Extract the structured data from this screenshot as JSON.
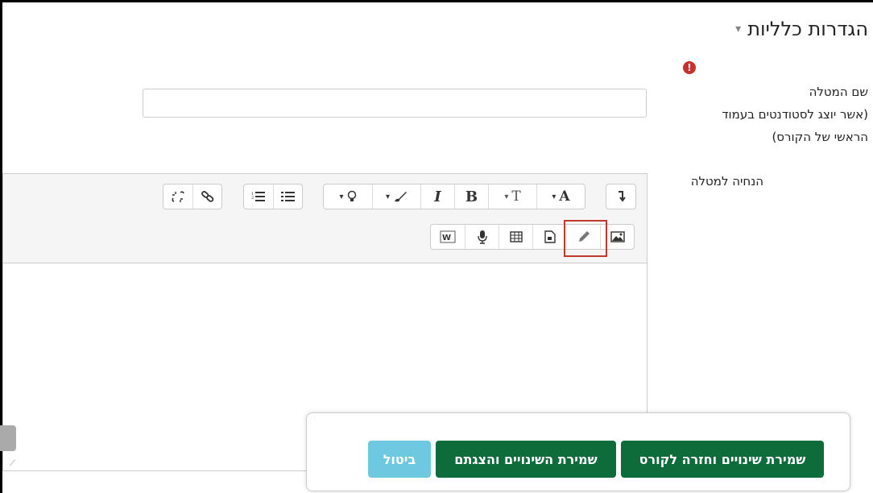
{
  "section": {
    "title": "הגדרות כלליות",
    "caret": "▾"
  },
  "form": {
    "error_icon": "!",
    "name_label": [
      "שם המטלה",
      "(אשר יוצג לסטודנטים בעמוד",
      "הראשי של הקורס)"
    ],
    "name_value": "",
    "instructions_label": "הנחיה למטלה"
  },
  "toolbar": {
    "row1_text": {
      "font_color": "A",
      "font_size": "T",
      "bold": "B",
      "italic": "I",
      "dropdown_caret": "▾"
    },
    "icons": [
      "rtl-icon",
      "font-color-icon",
      "font-size-icon",
      "bold-icon",
      "italic-icon",
      "brush-icon",
      "lightbulb-icon",
      "bullet-list-icon",
      "numbered-list-icon",
      "link-icon",
      "unlink-icon",
      "image-icon",
      "pencil-icon",
      "video-icon",
      "table-icon",
      "microphone-icon",
      "word-paste-icon"
    ]
  },
  "footer": {
    "save_return": "שמירת שינויים וחזרה לקורס",
    "save_display": "שמירת השינויים והצגתם",
    "cancel": "ביטול"
  }
}
